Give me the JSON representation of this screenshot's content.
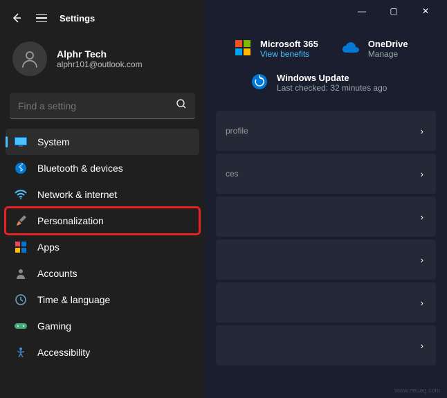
{
  "titlebar": {
    "minimize": "—",
    "maximize": "▢",
    "close": "✕"
  },
  "header": {
    "title": "Settings"
  },
  "profile": {
    "name": "Alphr Tech",
    "email": "alphr101@outlook.com"
  },
  "search": {
    "placeholder": "Find a setting"
  },
  "nav": {
    "items": [
      {
        "id": "system",
        "label": "System",
        "active": true
      },
      {
        "id": "bluetooth",
        "label": "Bluetooth & devices"
      },
      {
        "id": "network",
        "label": "Network & internet"
      },
      {
        "id": "personalization",
        "label": "Personalization",
        "highlighted": true
      },
      {
        "id": "apps",
        "label": "Apps"
      },
      {
        "id": "accounts",
        "label": "Accounts"
      },
      {
        "id": "time",
        "label": "Time & language"
      },
      {
        "id": "gaming",
        "label": "Gaming"
      },
      {
        "id": "accessibility",
        "label": "Accessibility"
      }
    ]
  },
  "status": {
    "m365": {
      "title": "Microsoft 365",
      "sub": "View benefits"
    },
    "onedrive": {
      "title": "OneDrive",
      "sub": "Manage"
    },
    "update": {
      "title": "Windows Update",
      "sub": "Last checked: 32 minutes ago"
    }
  },
  "rows": {
    "r1": "profile",
    "r2": "ces"
  },
  "watermark": "www.deuaq.com"
}
